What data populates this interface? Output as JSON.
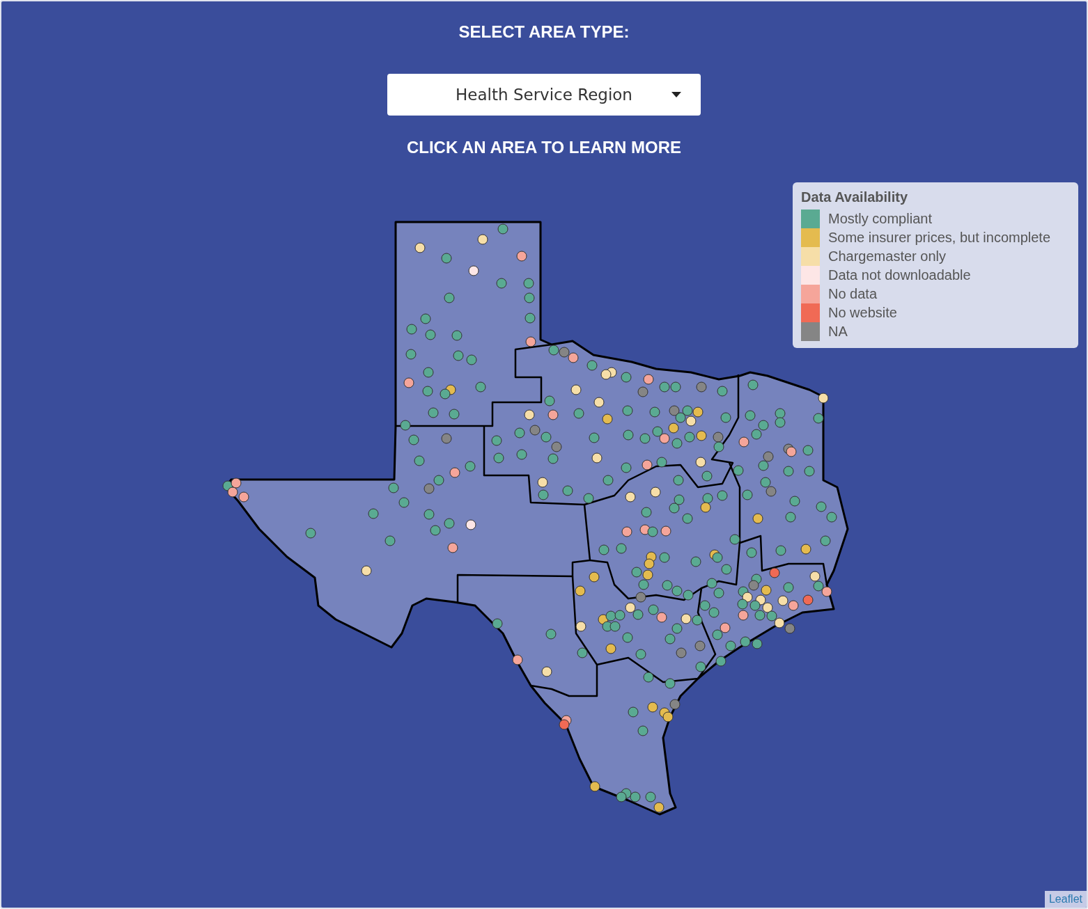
{
  "heading": "SELECT AREA TYPE:",
  "area_select": {
    "value": "Health Service Region"
  },
  "subheading": "CLICK AN AREA TO LEARN MORE",
  "legend": {
    "title": "Data Availability",
    "items": [
      {
        "label": "Mostly compliant",
        "color": "#5aaa92"
      },
      {
        "label": "Some insurer prices, but incomplete",
        "color": "#e4bb4f"
      },
      {
        "label": "Chargemaster only",
        "color": "#f6dea8"
      },
      {
        "label": "Data not downloadable",
        "color": "#fde6e6"
      },
      {
        "label": "No data",
        "color": "#f5a59a"
      },
      {
        "label": "No website",
        "color": "#f06a55"
      },
      {
        "label": "NA",
        "color": "#858585"
      }
    ]
  },
  "attribution": "Leaflet"
}
